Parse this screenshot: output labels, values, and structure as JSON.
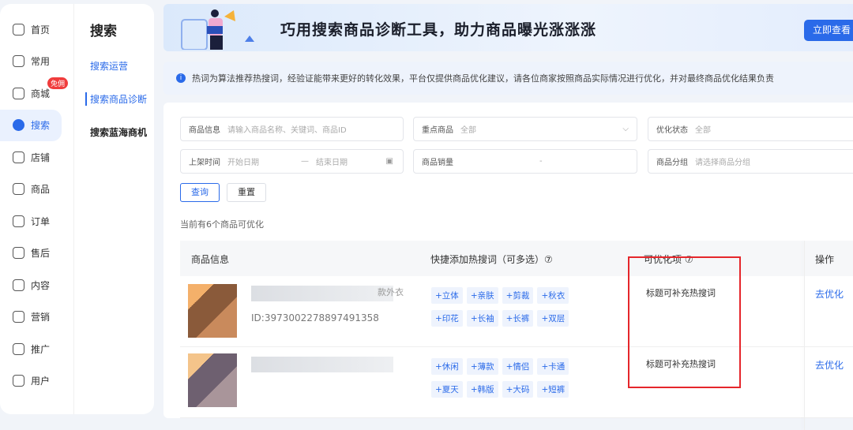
{
  "nav": {
    "items": [
      {
        "label": "首页"
      },
      {
        "label": "常用"
      },
      {
        "label": "商城",
        "badge": "免佣"
      },
      {
        "label": "搜索",
        "active": true
      },
      {
        "label": "店铺"
      },
      {
        "label": "商品"
      },
      {
        "label": "订单"
      },
      {
        "label": "售后"
      },
      {
        "label": "内容"
      },
      {
        "label": "营销"
      },
      {
        "label": "推广"
      },
      {
        "label": "用户"
      }
    ]
  },
  "subnav": {
    "title": "搜索",
    "items": [
      "搜索运营",
      "搜索商品诊断",
      "搜索蓝海商机"
    ]
  },
  "banner": {
    "title": "巧用搜索商品诊断工具，助力商品曝光涨涨涨",
    "button": "立即查看"
  },
  "notice": "热词为算法推荐热搜词，经验证能带来更好的转化效果，平台仅提供商品优化建议，请各位商家按照商品实际情况进行优化，并对最终商品优化结果负责",
  "filters": {
    "product_info": {
      "label": "商品信息",
      "placeholder": "请输入商品名称、关键词、商品ID"
    },
    "key_product": {
      "label": "重点商品",
      "value": "全部"
    },
    "opt_status": {
      "label": "优化状态",
      "value": "全部"
    },
    "list_time": {
      "label": "上架时间",
      "start": "开始日期",
      "sep": "—",
      "end": "结束日期"
    },
    "sales": {
      "label": "商品销量",
      "sep": "-"
    },
    "category": {
      "label": "商品分组",
      "placeholder": "请选择商品分组"
    },
    "query": "查询",
    "reset": "重置"
  },
  "count_text": "当前有6个商品可优化",
  "table": {
    "headers": [
      "商品信息",
      "快捷添加热搜词（可多选）⑦",
      "可优化项 ⑦",
      "操作"
    ],
    "rows": [
      {
        "id_text": "ID:3973002278897491358",
        "title_tail": "款外衣",
        "tags": [
          "+立体",
          "+亲肤",
          "+剪裁",
          "+秋衣",
          "+印花",
          "+长袖",
          "+长裤",
          "+双层"
        ],
        "suggestion": "标题可补充热搜词",
        "action": "去优化"
      },
      {
        "tags": [
          "+休闲",
          "+薄款",
          "+情侣",
          "+卡通",
          "+夏天",
          "+韩版",
          "+大码",
          "+短裤"
        ],
        "suggestion": "标题可补充热搜词",
        "action": "去优化"
      }
    ]
  }
}
